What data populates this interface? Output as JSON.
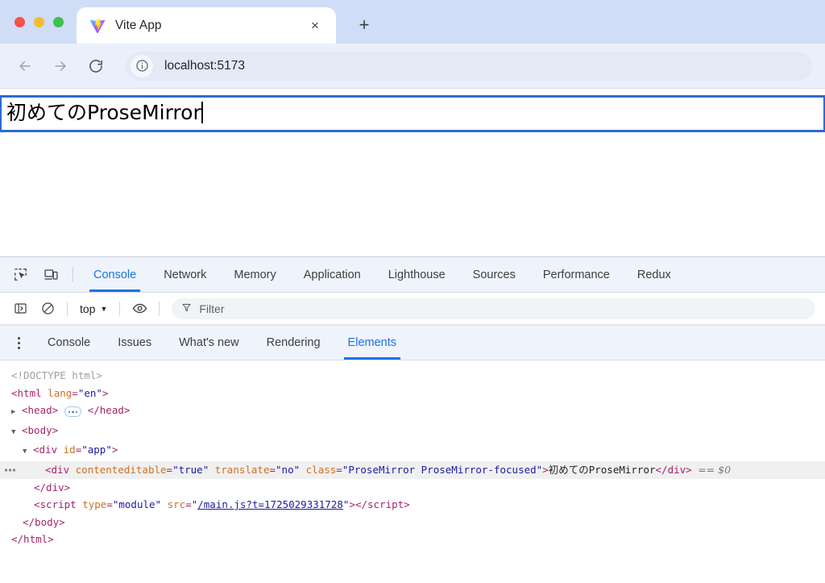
{
  "window": {
    "traffic_lights": [
      "close",
      "minimize",
      "maximize"
    ],
    "colors": {
      "close": "#f35349",
      "minimize": "#f5bb2f",
      "maximize": "#3ec14d",
      "tabstrip_bg": "#cfddf7",
      "accent": "#1a73e8"
    }
  },
  "tab": {
    "favicon": "vite-logo-icon",
    "title": "Vite App",
    "close_label": "×",
    "newtab_label": "+"
  },
  "toolbar": {
    "back_icon": "arrow-left-icon",
    "forward_icon": "arrow-right-icon",
    "reload_icon": "reload-icon",
    "site_info_icon": "info-circle-icon",
    "url": "localhost:5173"
  },
  "page": {
    "editor": {
      "content": "初めてのProseMirror",
      "focused": true,
      "border_color": "#2a6bd4"
    }
  },
  "devtools": {
    "inspect_icon": "inspect-element-icon",
    "device_icon": "device-toolbar-icon",
    "tabs": [
      {
        "label": "Console",
        "selected": true
      },
      {
        "label": "Network",
        "selected": false
      },
      {
        "label": "Memory",
        "selected": false
      },
      {
        "label": "Application",
        "selected": false
      },
      {
        "label": "Lighthouse",
        "selected": false
      },
      {
        "label": "Sources",
        "selected": false
      },
      {
        "label": "Performance",
        "selected": false
      },
      {
        "label": "Redux",
        "selected": false
      }
    ],
    "console_bar": {
      "sidebar_icon": "console-sidebar-icon",
      "clear_icon": "clear-console-icon",
      "context_value": "top",
      "context_caret": "▼",
      "eye_icon": "live-expression-eye-icon",
      "filter_icon": "filter-funnel-icon",
      "filter_placeholder": "Filter",
      "filter_value": ""
    },
    "drawer_tabs": [
      {
        "label": "Console",
        "selected": false
      },
      {
        "label": "Issues",
        "selected": false
      },
      {
        "label": "What's new",
        "selected": false
      },
      {
        "label": "Rendering",
        "selected": false
      },
      {
        "label": "Elements",
        "selected": true
      }
    ],
    "more_icon": "kebab-menu-icon"
  },
  "dom_tree": {
    "doctype": "<!DOCTYPE html>",
    "html_open_tag": "<html",
    "html_attr_name": "lang",
    "html_attr_value": "\"en\"",
    "html_open_close": ">",
    "head_open": "<head>",
    "head_close": "</head>",
    "body_open": "<body>",
    "div_app_open": "<div",
    "div_app_attr": "id",
    "div_app_value": "\"app\"",
    "div_app_close_bracket": ">",
    "selected_row": {
      "open": "<div",
      "attrs": [
        {
          "name": "contenteditable",
          "value": "\"true\""
        },
        {
          "name": "translate",
          "value": "\"no\""
        },
        {
          "name": "class",
          "value": "\"ProseMirror ProseMirror-focused\""
        }
      ],
      "bracket": ">",
      "text": "初めてのProseMirror",
      "close": "</div>",
      "selected_marker": "== $0"
    },
    "div_close": "</div>",
    "script_open": "<script",
    "script_attr_type_name": "type",
    "script_attr_type_value": "\"module\"",
    "script_attr_src_name": "src",
    "script_attr_src_value": "/main.js?t=1725029331728",
    "script_bracket": ">",
    "script_close": "</script>",
    "body_close": "</body>",
    "html_close": "</html>",
    "expand_arrow_collapsed": "▶",
    "expand_arrow_expanded": "▼"
  }
}
